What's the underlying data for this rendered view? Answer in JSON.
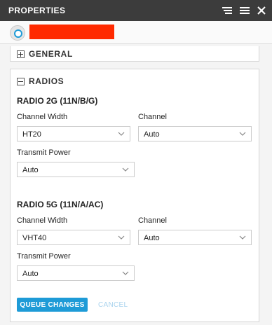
{
  "header": {
    "title": "PROPERTIES",
    "icons": [
      "sort-lines-icon",
      "menu-lines-icon",
      "close-icon"
    ]
  },
  "device": {
    "icon": "device-status-icon",
    "name_redacted_color": "#ff2a00"
  },
  "sections": {
    "general": {
      "label": "GENERAL",
      "expanded": false
    },
    "radios": {
      "label": "RADIOS",
      "expanded": true
    }
  },
  "radio_2g": {
    "title": "RADIO 2G (11N/B/G)",
    "channel_width_label": "Channel Width",
    "channel_width_value": "HT20",
    "channel_label": "Channel",
    "channel_value": "Auto",
    "transmit_power_label": "Transmit Power",
    "transmit_power_value": "Auto"
  },
  "radio_5g": {
    "title": "RADIO 5G (11N/A/AC)",
    "channel_width_label": "Channel Width",
    "channel_width_value": "VHT40",
    "channel_label": "Channel",
    "channel_value": "Auto",
    "transmit_power_label": "Transmit Power",
    "transmit_power_value": "Auto"
  },
  "actions": {
    "queue_label": "QUEUE CHANGES",
    "cancel_label": "CANCEL"
  },
  "colors": {
    "header_bg": "#3c3c3c",
    "accent": "#1e9bd7",
    "disabled_text": "#a9d3ee"
  }
}
